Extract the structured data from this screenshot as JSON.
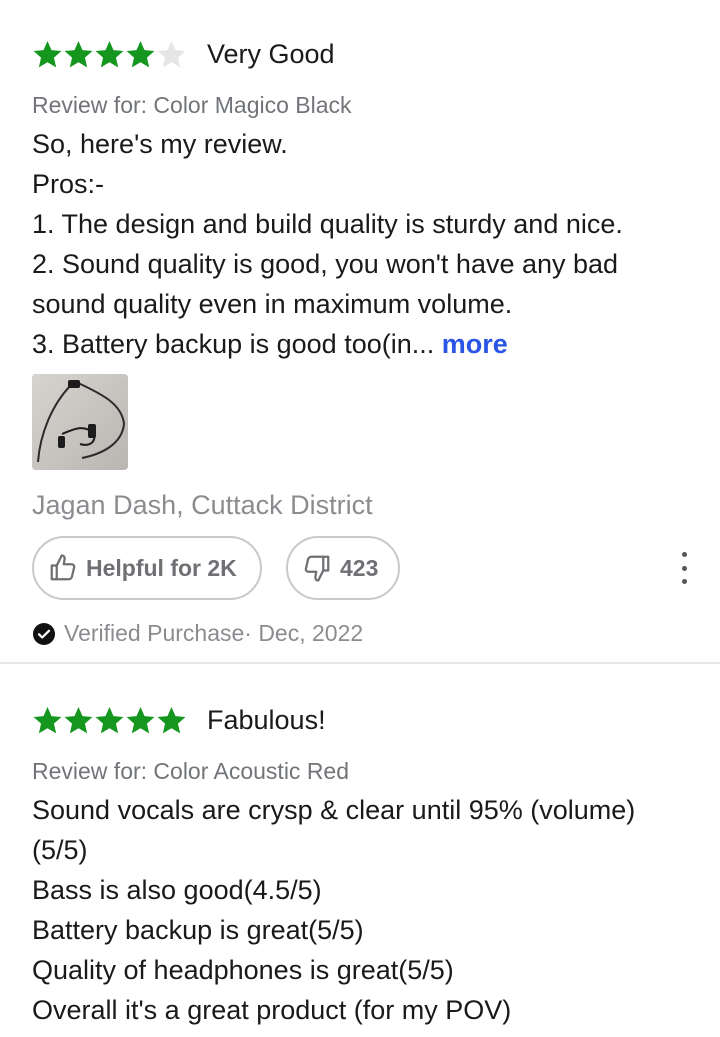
{
  "reviews": [
    {
      "rating": 4,
      "rating_max": 5,
      "headline": "Very Good",
      "review_for": "Review for: Color Magico Black",
      "lines": [
        "So, here's my review.",
        "Pros:-",
        "1. The design and build quality is sturdy and nice.",
        "2. Sound quality is good, you won't have any bad",
        "sound quality even in maximum volume.",
        "3. Battery backup is good too(in... "
      ],
      "more_label": "more",
      "author": "Jagan Dash, Cuttack District",
      "helpful_label": "Helpful for 2K",
      "dislike_count": "423",
      "verified_text": "Verified Purchase· Dec, 2022"
    },
    {
      "rating": 5,
      "rating_max": 5,
      "headline": "Fabulous!",
      "review_for": "Review for: Color Acoustic Red",
      "lines": [
        "Sound vocals are crysp & clear until 95% (volume)",
        "(5/5)",
        "Bass is also good(4.5/5)",
        "Battery backup is great(5/5)",
        "Quality of headphones is great(5/5)",
        "Overall it's a great product (for my POV)"
      ]
    }
  ],
  "colors": {
    "star_filled": "#14961f",
    "star_empty": "#e6e6e6",
    "link": "#2a55e5"
  },
  "icons": {
    "thumbs_up": "thumbs-up-icon",
    "thumbs_down": "thumbs-down-icon",
    "verified": "check-circle-icon",
    "menu": "more-vertical-icon"
  }
}
